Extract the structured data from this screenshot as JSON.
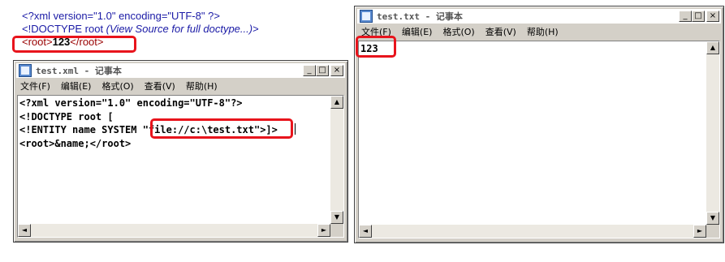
{
  "browser": {
    "line1": "<?xml version=\"1.0\" encoding=\"UTF-8\" ?>",
    "line2_doctype": "<!DOCTYPE root ",
    "line2_hint": "(View Source for full doctype...)",
    "line2_close": ">",
    "root_open": "<root>",
    "root_value": "123",
    "root_close": "</root>"
  },
  "xml_window": {
    "title": "test.xml - 记事本",
    "menu": [
      "文件(F)",
      "编辑(E)",
      "格式(O)",
      "查看(V)",
      "帮助(H)"
    ],
    "lines": [
      "<?xml version=\"1.0\" encoding=\"UTF-8\"?>",
      "<!DOCTYPE root [",
      "<!ENTITY name SYSTEM \"file://c:\\test.txt\">]>",
      "<root>&name;</root>"
    ]
  },
  "txt_window": {
    "title": "test.txt - 记事本",
    "menu": [
      "文件(F)",
      "编辑(E)",
      "格式(O)",
      "查看(V)",
      "帮助(H)"
    ],
    "content": "123"
  },
  "window_buttons": {
    "minimize": "_",
    "maximize": "□",
    "close": "×"
  },
  "scroll_arrows": {
    "up": "▲",
    "down": "▼",
    "left": "◄",
    "right": "►"
  },
  "colors": {
    "highlight": "#e8141c",
    "xml_markup": "#1a1aa6",
    "xml_tag": "#990000"
  }
}
